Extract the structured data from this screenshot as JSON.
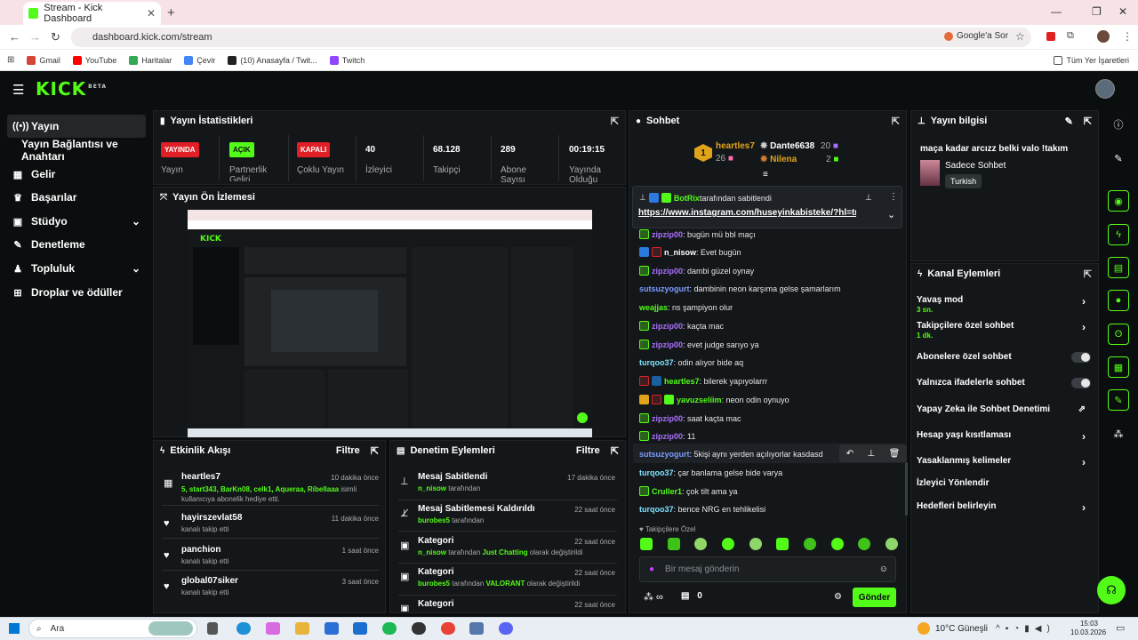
{
  "browser": {
    "tab_title": "Stream - Kick Dashboard",
    "url": "dashboard.kick.com/stream",
    "google_btn": "Google'a Sor",
    "bookmarks": [
      "Gmail",
      "YouTube",
      "Haritalar",
      "Çevir",
      "(10) Anasayfa / Twit...",
      "Twitch"
    ],
    "all_bookmarks": "Tüm Yer İşaretleri"
  },
  "sidebar": {
    "items": [
      {
        "label": "Yayın",
        "icon": "broadcast-icon"
      },
      {
        "label": "Yayın Bağlantısı ve Anahtarı",
        "icon": ""
      },
      {
        "label": "Gelir",
        "icon": "income-icon"
      },
      {
        "label": "Başarılar",
        "icon": "trophy-icon"
      },
      {
        "label": "Stüdyo",
        "icon": "studio-icon"
      },
      {
        "label": "Denetleme",
        "icon": "wrench-icon"
      },
      {
        "label": "Topluluk",
        "icon": "community-icon"
      },
      {
        "label": "Droplar ve ödüller",
        "icon": "gift-icon"
      }
    ]
  },
  "stats": {
    "title": "Yayın İstatistikleri",
    "items": [
      {
        "value": "YAYINDA",
        "label": "Yayın"
      },
      {
        "value": "AÇIK",
        "label": "Partnerlik Geliri"
      },
      {
        "value": "KAPALI",
        "label": "Çoklu Yayın"
      },
      {
        "value": "40",
        "label": "İzleyici"
      },
      {
        "value": "68.128",
        "label": "Takipçi"
      },
      {
        "value": "289",
        "label": "Abone Sayısı"
      },
      {
        "value": "00:19:15",
        "label": "Yayında Olduğu"
      }
    ]
  },
  "preview": {
    "title": "Yayın Ön İzlemesi"
  },
  "events": {
    "title": "Etkinlik Akışı",
    "filter": "Filtre",
    "items": [
      {
        "name": "heartles7",
        "time": "10 dakika önce",
        "desc_highlight": "5, start343, BarKn08, celk1, Aqueraa, Ribellaaa",
        "desc": " isimli kullanıcıya abonelik hediye etti."
      },
      {
        "name": "hayirszevlat58",
        "time": "11 dakika önce",
        "desc": "kanalı takip etti"
      },
      {
        "name": "panchion",
        "time": "1 saat önce",
        "desc": "kanalı takip etti"
      },
      {
        "name": "global07siker",
        "time": "3 saat önce",
        "desc": "kanalı takip etti"
      }
    ]
  },
  "moderation": {
    "title": "Denetim Eylemleri",
    "filter": "Filtre",
    "items": [
      {
        "title": "Mesaj Sabitlendi",
        "time": "17 dakika önce",
        "user": "n_nisow",
        "rest": " tarafından"
      },
      {
        "title": "Mesaj Sabitlemesi Kaldırıldı",
        "time": "22 saat önce",
        "user": "burobes5",
        "rest": " tarafından"
      },
      {
        "title": "Kategori",
        "time": "22 saat önce",
        "user": "n_nisow",
        "mid": " tarafından ",
        "cat": "Just Chatting",
        "rest": " olarak değiştirildi"
      },
      {
        "title": "Kategori",
        "time": "22 saat önce",
        "user": "burobes5",
        "mid": " tarafından ",
        "cat": "VALORANT",
        "rest": " olarak değiştirildi"
      },
      {
        "title": "Kategori",
        "time": "22 saat önce"
      }
    ]
  },
  "chat": {
    "title": "Sohbet",
    "leaders": [
      {
        "rank": "1",
        "name": "heartles7",
        "count": "26"
      },
      {
        "name": "Dante6638",
        "count": "20"
      },
      {
        "name": "Nilena",
        "count": "2"
      }
    ],
    "pinned_by": "BotRix",
    "pinned_by_rest": " tarafından sabitlendi",
    "pinned_link": "https://www.instagram.com/huseyinkabisteke/?hl=tr",
    "messages": [
      {
        "user": "zipzip00",
        "text": "bugün mü bbl maçı",
        "color": "#a970ff"
      },
      {
        "user": "n_nisow",
        "text": "Evet bugün",
        "color": "#ffffff"
      },
      {
        "user": "zipzip00",
        "text": "dambi güzel oynay",
        "color": "#a970ff"
      },
      {
        "user": "sutsuzyogurt",
        "text": "dambinin neon karşıma gelse şamarlarım",
        "color": "#7a9cff"
      },
      {
        "user": "weajjas",
        "text": "ns şampiyon olur",
        "color": "#53fc18"
      },
      {
        "user": "zipzip00",
        "text": "kaçta mac",
        "color": "#a970ff"
      },
      {
        "user": "zipzip00",
        "text": "evet judge sarıyo ya",
        "color": "#a970ff"
      },
      {
        "user": "turqoo37",
        "text": "odin alıyor bide aq",
        "color": "#7fe3ff"
      },
      {
        "user": "heartles7",
        "text": "bilerek yapıyolarrr",
        "color": "#53fc18"
      },
      {
        "user": "yavuzseliim",
        "text": "neon odin oynuyo",
        "color": "#53fc18"
      },
      {
        "user": "zipzip00",
        "text": "saat kaçta mac",
        "color": "#a970ff"
      },
      {
        "user": "zipzip00",
        "text": "11",
        "color": "#a970ff"
      },
      {
        "user": "sutsuzyogurt",
        "text": "5kişi aynı yerden açılıyorlar kasdasd",
        "color": "#7a9cff"
      },
      {
        "user": "turqoo37",
        "text": "çar banlama gelse bide varya",
        "color": "#7fe3ff"
      },
      {
        "user": "Cruller1",
        "text": "çok tilt ama ya",
        "color": "#53fc18"
      },
      {
        "user": "turqoo37",
        "text": "bence NRG en tehlikelisi",
        "color": "#7fe3ff"
      }
    ],
    "followers_only": "Takipçilere Özel",
    "placeholder": "Bir mesaj gönderin",
    "send": "Gönder",
    "points": "0"
  },
  "stream_info": {
    "title": "Yayın bilgisi",
    "stream_title": "maça kadar arcızz belki valo !takım",
    "category": "Sadece Sohbet",
    "tag": "Turkish"
  },
  "channel": {
    "title": "Kanal Eylemleri",
    "items": [
      {
        "label": "Yavaş mod",
        "sub": "3 sn.",
        "kind": "arrow"
      },
      {
        "label": "Takipçilere özel sohbet",
        "sub": "1 dk.",
        "kind": "arrow"
      },
      {
        "label": "Abonelere özel sohbet",
        "kind": "toggle"
      },
      {
        "label": "Yalnızca ifadelerle sohbet",
        "kind": "toggle"
      },
      {
        "label": "Yapay Zeka ile Sohbet Denetimi",
        "kind": "ext"
      },
      {
        "label": "Hesap yaşı kısıtlaması",
        "kind": "arrow"
      },
      {
        "label": "Yasaklanmış kelimeler",
        "kind": "arrow"
      },
      {
        "label": "İzleyici Yönlendir",
        "kind": "none"
      },
      {
        "label": "Hedefleri belirleyin",
        "kind": "arrow"
      }
    ]
  },
  "taskbar": {
    "search": "Ara",
    "weather": "10°C  Güneşli",
    "time": "15:03",
    "date": "10.03.2026"
  }
}
